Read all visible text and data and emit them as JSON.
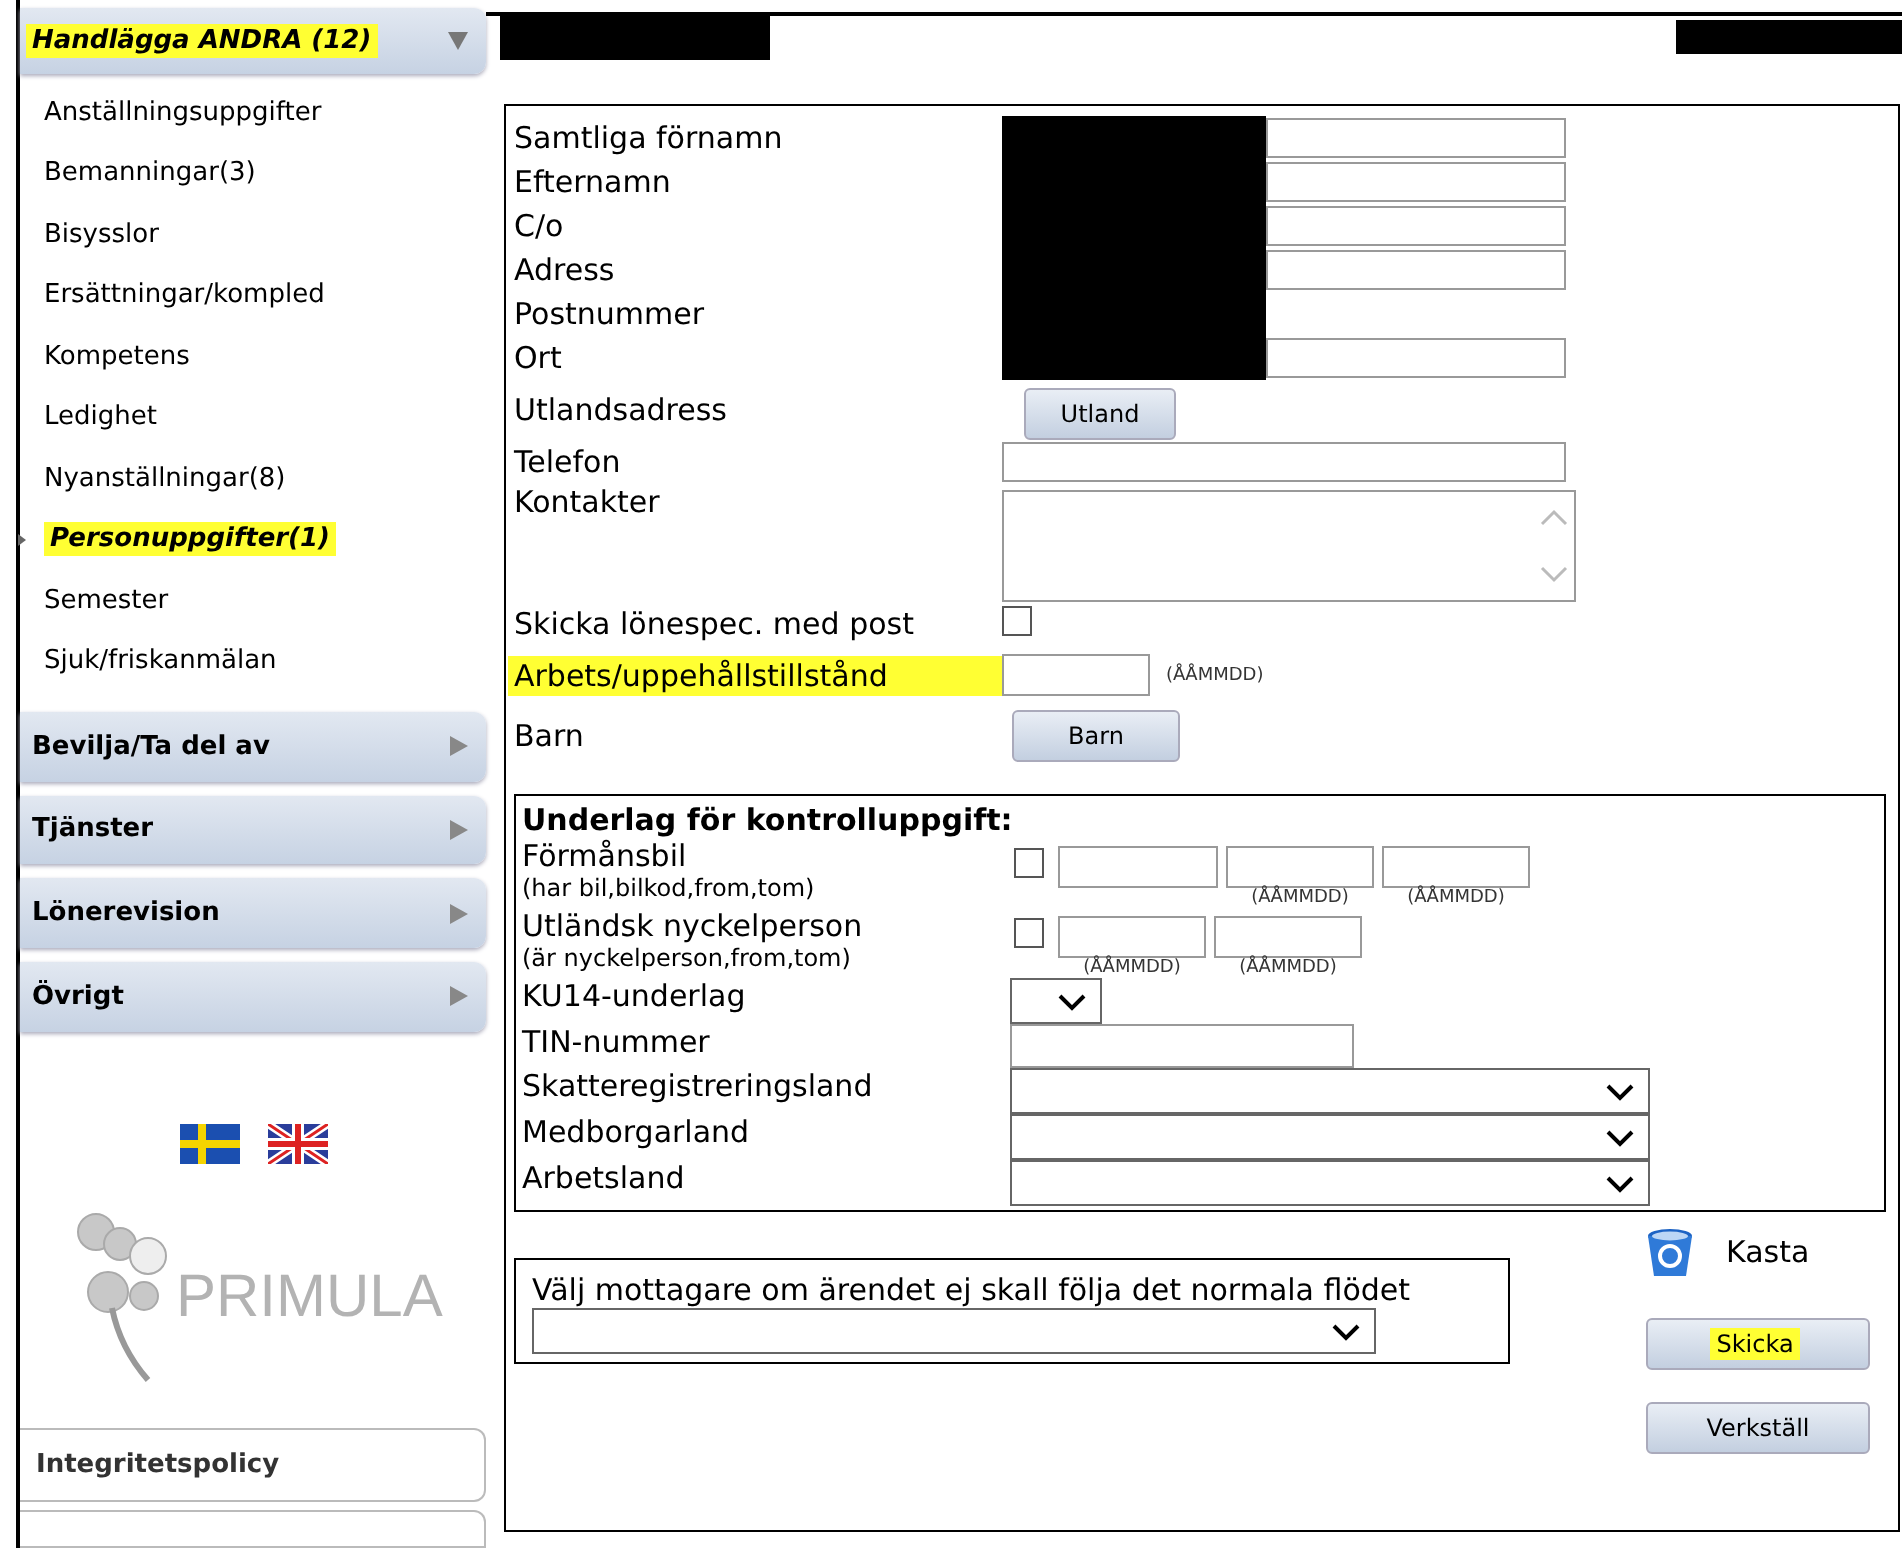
{
  "header": {
    "redacted": true
  },
  "sidebar": {
    "sections": [
      {
        "title": "Handlägga ANDRA (12)",
        "expanded": true,
        "highlighted": true,
        "items": [
          {
            "label": "Anställningsuppgifter",
            "selected": false,
            "highlighted": false
          },
          {
            "label": "Bemanningar(3)",
            "selected": false,
            "highlighted": false
          },
          {
            "label": "Bisysslor",
            "selected": false,
            "highlighted": false
          },
          {
            "label": "Ersättningar/kompled",
            "selected": false,
            "highlighted": false
          },
          {
            "label": "Kompetens",
            "selected": false,
            "highlighted": false
          },
          {
            "label": "Ledighet",
            "selected": false,
            "highlighted": false
          },
          {
            "label": "Nyanställningar(8)",
            "selected": false,
            "highlighted": false
          },
          {
            "label": "Personuppgifter(1)",
            "selected": true,
            "highlighted": true
          },
          {
            "label": "Semester",
            "selected": false,
            "highlighted": false
          },
          {
            "label": "Sjuk/friskanmälan",
            "selected": false,
            "highlighted": false
          }
        ]
      },
      {
        "title": "Bevilja/Ta del av",
        "expanded": false,
        "highlighted": false
      },
      {
        "title": "Tjänster",
        "expanded": false,
        "highlighted": false
      },
      {
        "title": "Lönerevision",
        "expanded": false,
        "highlighted": false
      },
      {
        "title": "Övrigt",
        "expanded": false,
        "highlighted": false
      }
    ],
    "languages": [
      {
        "kind": "swedish"
      },
      {
        "kind": "english"
      }
    ],
    "logo": {
      "text": "PRIMULA"
    },
    "links": [
      "Integritetspolicy"
    ]
  },
  "form": {
    "rows": [
      {
        "label": "Samtliga förnamn",
        "kind": "text",
        "redacted": true,
        "highlighted": false
      },
      {
        "label": "Efternamn",
        "kind": "text",
        "redacted": true,
        "highlighted": false
      },
      {
        "label": "C/o",
        "kind": "text",
        "redacted": true,
        "highlighted": false
      },
      {
        "label": "Adress",
        "kind": "text",
        "redacted": true,
        "highlighted": false
      },
      {
        "label": "Postnummer",
        "kind": "label",
        "redacted": true,
        "highlighted": false
      },
      {
        "label": "Ort",
        "kind": "text",
        "redacted": true,
        "highlighted": false
      },
      {
        "label": "Utlandsadress",
        "kind": "button",
        "button": "Utland",
        "highlighted": false
      },
      {
        "label": "Telefon",
        "kind": "text",
        "highlighted": false
      },
      {
        "label": "Kontakter",
        "kind": "textarea",
        "highlighted": false
      },
      {
        "label": "Skicka lönespec. med post",
        "kind": "checkbox",
        "checked": false,
        "highlighted": false
      },
      {
        "label": "Arbets/uppehållstillstånd",
        "kind": "date",
        "hint": "(ÅÅMMDD)",
        "highlighted": true
      },
      {
        "label": "Barn",
        "kind": "button",
        "button": "Barn",
        "highlighted": false
      }
    ]
  },
  "control_data": {
    "title": "Underlag för kontrolluppgift:",
    "rows": [
      {
        "kind": "multi",
        "label": "Förmånsbil",
        "sublabel": "(har bil,bilkod,from,tom)",
        "checked": false,
        "inputs": [
          {
            "kind": "plain"
          },
          {
            "kind": "date",
            "hint": "(ÅÅMMDD)"
          },
          {
            "kind": "date",
            "hint": "(ÅÅMMDD)"
          }
        ]
      },
      {
        "kind": "multi",
        "label": "Utländsk nyckelperson",
        "sublabel": "(är nyckelperson,from,tom)",
        "checked": false,
        "inputs": [
          {
            "kind": "date",
            "hint": "(ÅÅMMDD)"
          },
          {
            "kind": "date",
            "hint": "(ÅÅMMDD)"
          }
        ]
      },
      {
        "kind": "small-select",
        "label": "KU14-underlag"
      },
      {
        "kind": "text",
        "label": "TIN-nummer"
      },
      {
        "kind": "select",
        "label": "Skatteregistreringsland"
      },
      {
        "kind": "select",
        "label": "Medborgarland"
      },
      {
        "kind": "select",
        "label": "Arbetsland"
      }
    ]
  },
  "receiver": {
    "label": "Välj mottagare om ärendet ej skall följa det normala flödet"
  },
  "actions": {
    "discard": "Kasta",
    "buttons": [
      {
        "label": "Skicka",
        "highlighted": true
      },
      {
        "label": "Verkställ",
        "highlighted": false
      }
    ]
  }
}
